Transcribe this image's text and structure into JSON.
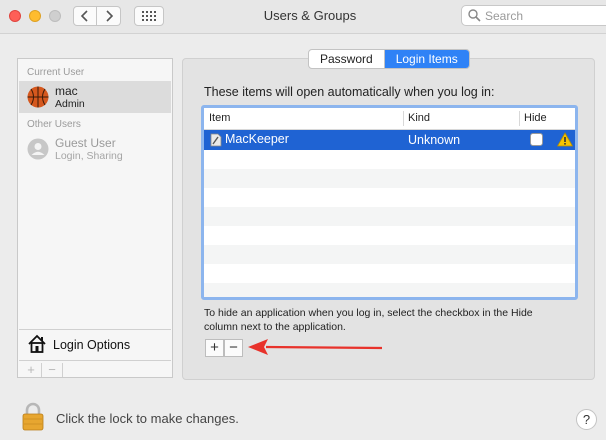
{
  "window": {
    "title": "Users & Groups"
  },
  "search": {
    "placeholder": "Search"
  },
  "users": {
    "current_label": "Current User",
    "current": {
      "name": "mac",
      "role": "Admin"
    },
    "other_label": "Other Users",
    "others": [
      {
        "name": "Guest User",
        "role": "Login, Sharing"
      }
    ]
  },
  "login_options_label": "Login Options",
  "tabs": [
    {
      "label": "Password",
      "active": false
    },
    {
      "label": "Login Items",
      "active": true
    }
  ],
  "login_items": {
    "intro": "These items will open automatically when you log in:",
    "columns": [
      "Item",
      "Kind",
      "Hide"
    ],
    "rows": [
      {
        "item": "MacKeeper",
        "kind": "Unknown",
        "hide": false
      }
    ],
    "hint": "To hide an application when you log in, select the checkbox in the Hide column next to the application."
  },
  "lock_text": "Click the lock to make changes.",
  "help_label": "?",
  "colors": {
    "selection": "#1f63d3",
    "accent": "#2f82f6",
    "arrow": "#e8322b"
  }
}
